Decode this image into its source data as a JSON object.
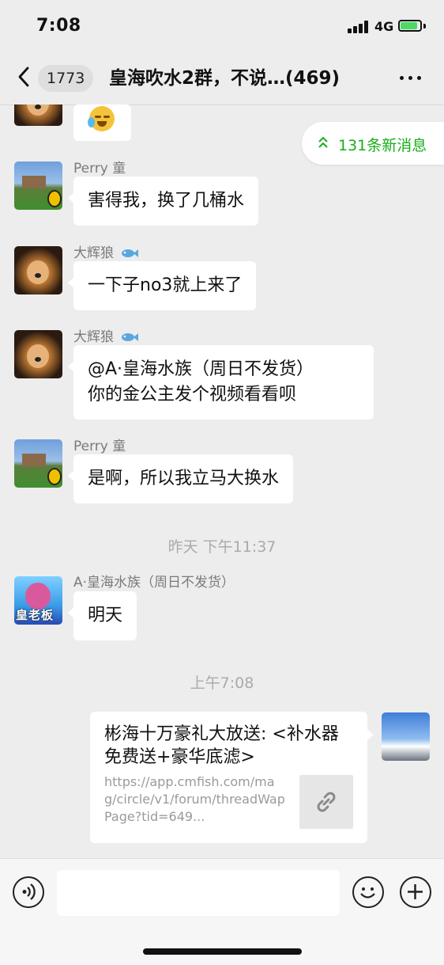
{
  "status_bar": {
    "time": "7:08",
    "network": "4G"
  },
  "nav": {
    "unread_count": "1773",
    "title": "皇海吹水2群，不说…(469)"
  },
  "new_messages": {
    "label": "131条新消息"
  },
  "messages": [
    {
      "sender": "Perry 童",
      "text": "害得我，换了几桶水"
    },
    {
      "sender": "大辉狼",
      "text": "一下子no3就上来了"
    },
    {
      "sender": "大辉狼",
      "text_line1": "@A·皇海水族（周日不发货）",
      "text_line2": "你的金公主发个视频看看呗"
    },
    {
      "sender": "Perry 童",
      "text": "是啊，所以我立马大换水"
    },
    {
      "sender": "A·皇海水族（周日不发货）",
      "text": "明天",
      "avatar_text": "皇老板"
    }
  ],
  "timestamps": {
    "yesterday": "昨天 下午11:37",
    "today": "上午7:08"
  },
  "link_card": {
    "title": "彬海十万豪礼大放送: <补水器免费送+豪华底滤>",
    "url": "https://app.cmfish.com/mag/circle/v1/forum/threadWapPage?tid=649..."
  },
  "colors": {
    "accent_green": "#1aad19",
    "background": "#ededed"
  },
  "icons": [
    "back-chevron-icon",
    "more-icon",
    "double-chevron-up-icon",
    "fish-icon",
    "link-icon",
    "voice-icon",
    "emoji-icon",
    "plus-icon"
  ]
}
